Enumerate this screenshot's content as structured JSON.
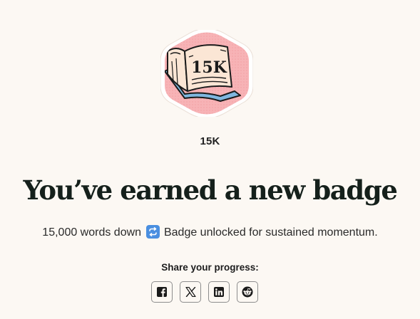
{
  "badge": {
    "image_text": "15K",
    "name": "15K",
    "colors": {
      "frame": "#ffffff",
      "background": "#f7b3b6",
      "book_cover": "#7fb7df",
      "page": "#fbe6d5",
      "ink": "#1b1b1b"
    }
  },
  "headline": "You’ve earned a new badge",
  "message": {
    "before": "15,000 words down",
    "emoji": "repeat-icon",
    "after": "Badge unlocked for sustained momentum."
  },
  "share": {
    "label": "Share your progress:",
    "buttons": [
      {
        "name": "facebook",
        "icon": "facebook-icon"
      },
      {
        "name": "x",
        "icon": "x-icon"
      },
      {
        "name": "linkedin",
        "icon": "linkedin-icon"
      },
      {
        "name": "reddit",
        "icon": "reddit-icon"
      }
    ]
  }
}
